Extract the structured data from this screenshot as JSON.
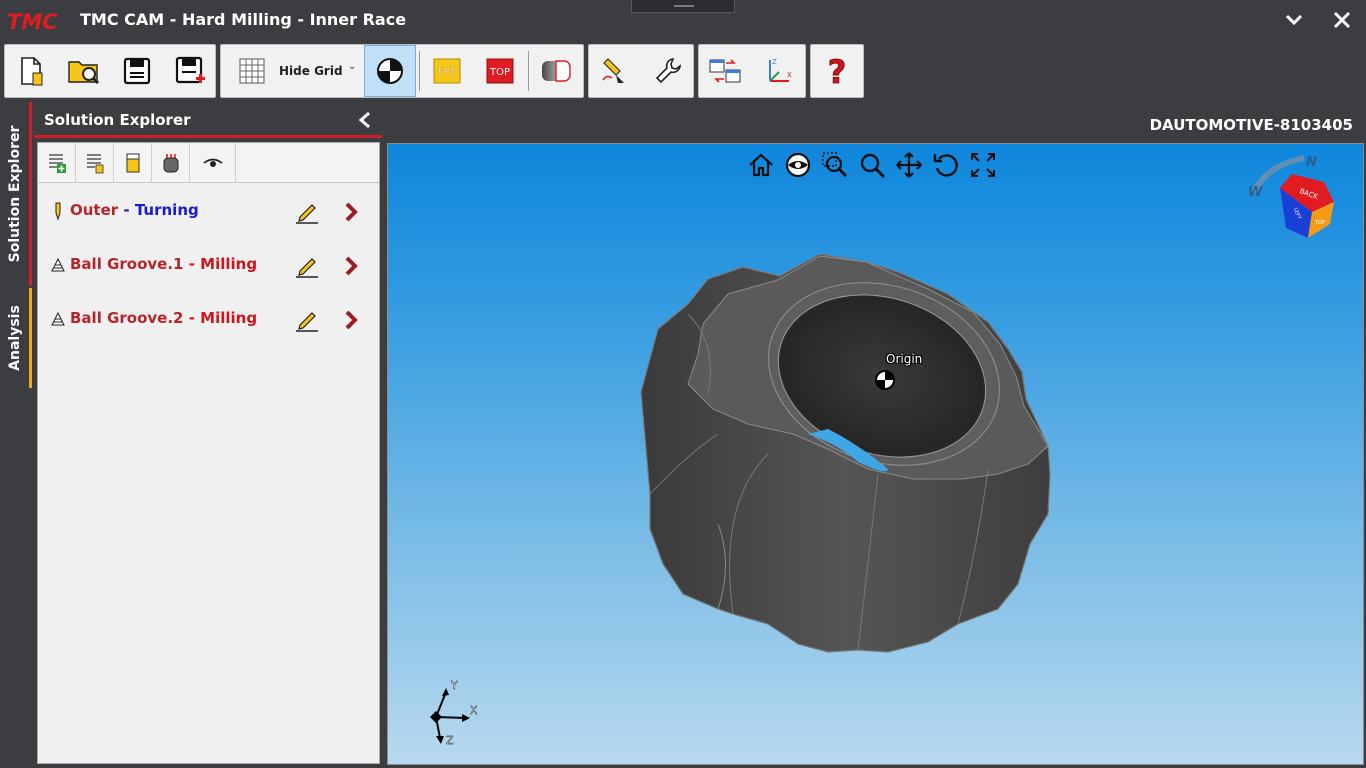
{
  "titlebar": {
    "logo_text": "TMC",
    "title": "TMC CAM - Hard Milling - Inner Race",
    "minimize_icon": "chevron-down-icon",
    "close_icon": "close-icon"
  },
  "toolbar": {
    "hide_grid_label": "Hide Grid",
    "front_label": "FRT",
    "top_label": "TOP",
    "buttons": [
      "new-file-icon",
      "open-file-icon",
      "save-icon",
      "save-as-icon",
      "grid-icon",
      "center-view-icon",
      "front-view-icon",
      "top-view-icon",
      "section-view-icon",
      "tool-edit-icon",
      "settings-wrench-icon",
      "swap-icon",
      "axis-config-icon",
      "help-icon"
    ]
  },
  "sidetabs": {
    "solution_explorer": "Solution Explorer",
    "analysis": "Analysis"
  },
  "explorer": {
    "title": "Solution Explorer",
    "operations": [
      {
        "name": "Outer",
        "separator": " - ",
        "type": "Turning",
        "type_color": "#1a1ad6"
      },
      {
        "name": "Ball Groove.1",
        "separator": " - ",
        "type": "Milling",
        "type_color": "#d0141c"
      },
      {
        "name": "Ball Groove.2",
        "separator": " - ",
        "type": "Milling",
        "type_color": "#d0141c"
      }
    ]
  },
  "viewport": {
    "machine_id": "DAUTOMOTIVE-8103405",
    "origin_label": "Origin",
    "view_tools": [
      "home-icon",
      "eye-icon",
      "zoom-window-icon",
      "zoom-icon",
      "pan-icon",
      "rotate-icon",
      "fit-screen-icon"
    ],
    "compass": {
      "north": "N",
      "west": "W"
    },
    "cube_faces": {
      "right": "BACK",
      "front": "TOP",
      "left": "LEFT"
    },
    "axes": {
      "x": "X",
      "y": "Y",
      "z": "Z"
    }
  },
  "colors": {
    "chrome": "#3b3d40",
    "accent_red": "#d21d24",
    "accent_orange": "#f3a818",
    "viewport_top": "#0e86dc",
    "viewport_bottom": "#b8d9ef"
  }
}
